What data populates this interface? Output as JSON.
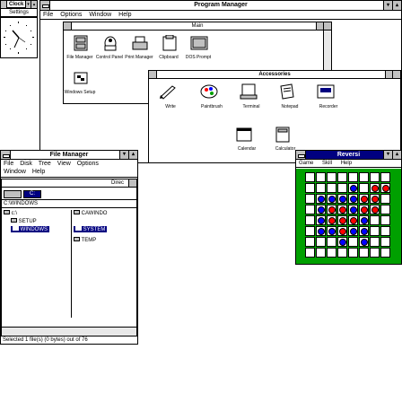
{
  "clock": {
    "title": "Clock"
  },
  "settings_icon": {
    "label": "Settings"
  },
  "program_manager": {
    "title": "Program Manager",
    "menu": [
      "File",
      "Options",
      "Window",
      "Help"
    ],
    "main_group": {
      "title": "Main",
      "icons": [
        "File Manager",
        "Control Panel",
        "Print Manager",
        "Clipboard",
        "DOS Prompt"
      ],
      "icons_row2": [
        "Windows Setup"
      ]
    },
    "accessories": {
      "title": "Accessories",
      "icons": [
        "Write",
        "Paintbrush",
        "Terminal",
        "Notepad",
        "Recorder"
      ],
      "icons_row2": [
        "Calendar",
        "Calculator"
      ]
    }
  },
  "file_manager": {
    "title": "File Manager",
    "menu": [
      "File",
      "Disk",
      "Tree",
      "View",
      "Options"
    ],
    "menu2": [
      "Window",
      "Help"
    ],
    "dir_title": "Direc",
    "drive_label": "C:",
    "path": "C:\\WINDOWS",
    "tree": [
      "c:\\",
      "SETUP",
      "WINDOWS"
    ],
    "files": [
      "CAWINDO",
      "SYSTEM",
      "TEMP"
    ],
    "status": "Selected 1 file(s) (0 bytes) out of 76"
  },
  "reversi": {
    "title": "Reversi",
    "menu": [
      "Game",
      "Skill",
      "Help"
    ],
    "colors": {
      "board": "#00a000",
      "blue": "#0000ff",
      "red": "#ff0000"
    },
    "board": [
      "........",
      "....B.RR",
      ".BBBBRR.",
      ".BRRBRR.",
      ".BRRRB..",
      ".BBRBB..",
      "...B.B..",
      "........"
    ]
  },
  "colors": {
    "active_title": "#000080",
    "chrome": "#c0c0c0"
  }
}
